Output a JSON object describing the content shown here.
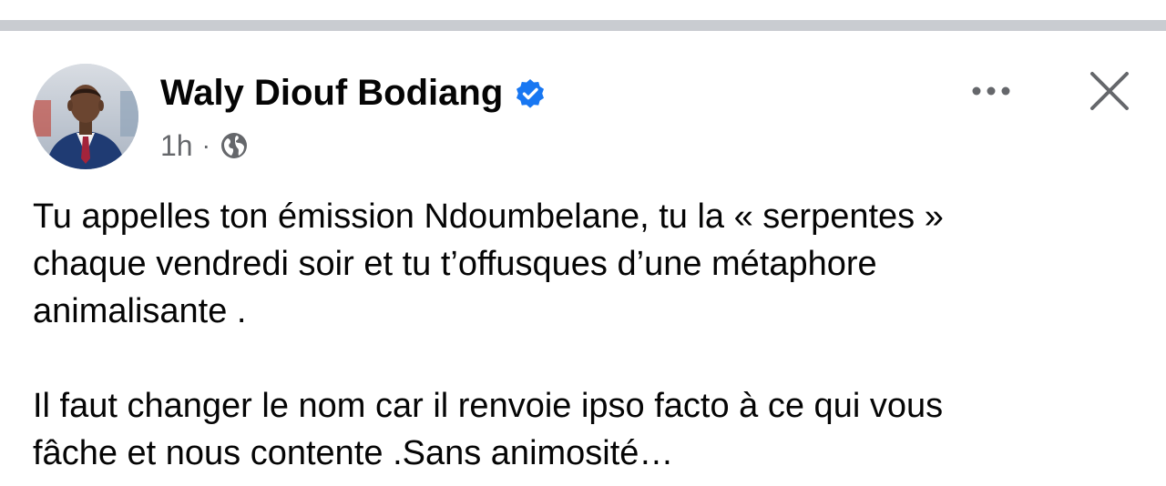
{
  "post": {
    "author": {
      "name": "Waly Diouf Bodiang",
      "verified": true,
      "avatar_icon": "person-in-suit-portrait"
    },
    "meta": {
      "time": "1h",
      "separator": "·",
      "audience_icon": "globe-icon"
    },
    "actions": {
      "more_icon": "more-horizontal-icon",
      "close_icon": "close-icon"
    },
    "paragraphs": [
      "Tu appelles ton émission Ndoumbelane, tu la « serpentes »\nchaque vendredi soir et tu t’offusques d’une métaphore\nanimalisante .",
      "Il faut changer le nom car il renvoie ipso facto à ce qui vous\nfâche et nous contente .Sans animosité…"
    ]
  },
  "colors": {
    "divider": "#c9ccd1",
    "verified_badge": "#1877f2",
    "meta_text": "#65676b",
    "body_text": "#050505"
  }
}
